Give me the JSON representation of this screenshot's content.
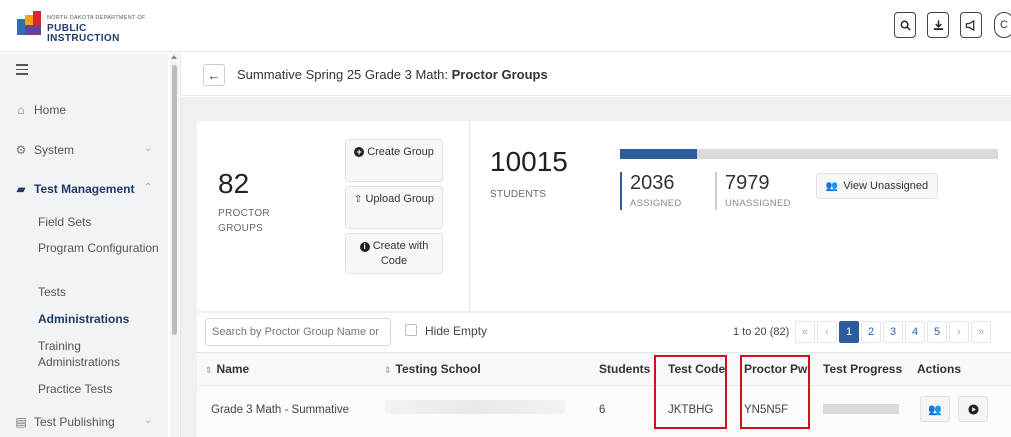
{
  "header": {
    "logo_small": "NORTH DAKOTA DEPARTMENT OF",
    "logo_big": "PUBLIC INSTRUCTION",
    "buttons": [
      "search-icon",
      "download-icon",
      "announcement-icon"
    ]
  },
  "sidebar": {
    "items": [
      {
        "label": "Home",
        "icon": "home-icon"
      },
      {
        "label": "System",
        "icon": "gear-icon"
      },
      {
        "label": "Test Management",
        "icon": "folder-icon"
      },
      {
        "label": "Test Publishing",
        "icon": "publish-icon"
      }
    ],
    "subitems": [
      "Field Sets",
      "Program Configuration",
      "Tests",
      "Administrations",
      "Training Administrations",
      "Practice Tests"
    ]
  },
  "breadcrumb": {
    "prefix": "Summative Spring 25 Grade 3 Math: ",
    "current": "Proctor Groups"
  },
  "summary": {
    "groups_count": "82",
    "groups_caption_1": "PROCTOR",
    "groups_caption_2": "GROUPS",
    "create_group": "Create Group",
    "upload_group": "Upload Group",
    "create_with_code": "Create with Code",
    "students_count": "10015",
    "students_caption": "STUDENTS",
    "assigned_count": "2036",
    "assigned_caption": "ASSIGNED",
    "unassigned_count": "7979",
    "unassigned_caption": "UNASSIGNED",
    "assigned_fraction": 0.2033,
    "view_unassigned": "View Unassigned",
    "colors": {
      "assigned": "#2c5d9a",
      "unassigned": "#c9ccd0"
    }
  },
  "table": {
    "search_placeholder": "Search by Proctor Group Name or",
    "hide_empty": "Hide Empty",
    "range": "1 to 20 (82)",
    "pages": [
      "«",
      "‹",
      "1",
      "2",
      "3",
      "4",
      "5",
      "›",
      "»"
    ],
    "columns": [
      "Name",
      "Testing School",
      "Students",
      "Test Code",
      "Proctor Pw",
      "Test Progress",
      "Actions"
    ],
    "rows": [
      {
        "name": "Grade 3 Math - Summative",
        "students": "6",
        "test_code": "JKTBHG",
        "proctor_pw": "YN5N5F"
      }
    ]
  }
}
